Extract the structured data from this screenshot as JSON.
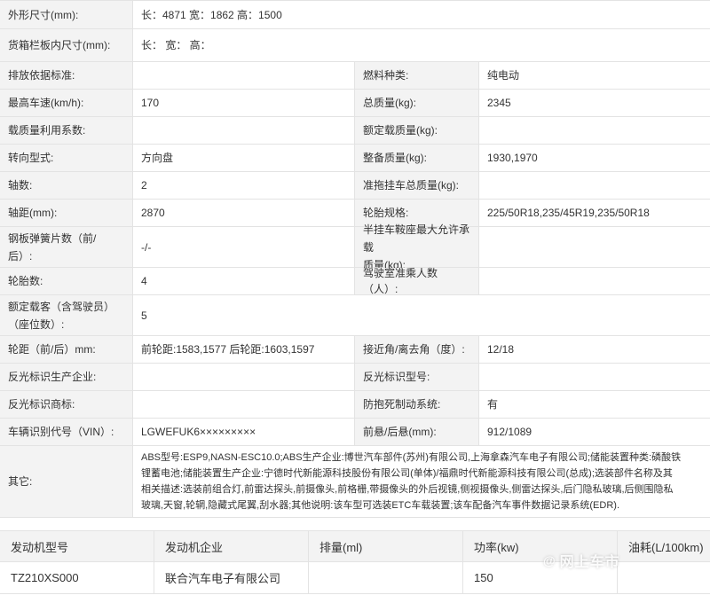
{
  "specs": {
    "r1": {
      "l": "外形尺寸(mm):",
      "v": "长：4871 宽：1862 高：1500"
    },
    "r2": {
      "l": "货箱栏板内尺寸(mm):",
      "v": "长： 宽： 高："
    },
    "r3": {
      "l1": "排放依据标准:",
      "v1": "",
      "l2": "燃料种类:",
      "v2": "纯电动"
    },
    "r4": {
      "l1": "最高车速(km/h):",
      "v1": "170",
      "l2": "总质量(kg):",
      "v2": "2345"
    },
    "r5": {
      "l1": "载质量利用系数:",
      "v1": "",
      "l2": "额定载质量(kg):",
      "v2": ""
    },
    "r6": {
      "l1": "转向型式:",
      "v1": "方向盘",
      "l2": "整备质量(kg):",
      "v2": "1930,1970"
    },
    "r7": {
      "l1": "轴数:",
      "v1": "2",
      "l2": "准拖挂车总质量(kg):",
      "v2": ""
    },
    "r8": {
      "l1": "轴距(mm):",
      "v1": "2870",
      "l2": "轮胎规格:",
      "v2": "225/50R18,235/45R19,235/50R18"
    },
    "r9": {
      "l1a": "钢板弹簧片数（前/",
      "l1b": "后）:",
      "v1": "-/-",
      "l2a": "半挂车鞍座最大允许承载",
      "l2b": "质量(kg):",
      "v2": ""
    },
    "r10": {
      "l1": "轮胎数:",
      "v1": "4",
      "l2": "驾驶室准乘人数（人）:",
      "v2": ""
    },
    "r11": {
      "la": "额定载客（含驾驶员）",
      "lb": "（座位数）:",
      "v": "5"
    },
    "r12": {
      "l1": "轮距（前/后）mm:",
      "v1": "前轮距:1583,1577 后轮距:1603,1597",
      "l2": "接近角/离去角（度）:",
      "v2": "12/18"
    },
    "r13": {
      "l1": "反光标识生产企业:",
      "v1": "",
      "l2": "反光标识型号:",
      "v2": ""
    },
    "r14": {
      "l1": "反光标识商标:",
      "v1": "",
      "l2": "防抱死制动系统:",
      "v2": "有"
    },
    "r15": {
      "l1": "车辆识别代号（VIN）:",
      "v1": "LGWEFUK6×××××××××",
      "l2": "前悬/后悬(mm):",
      "v2": "912/1089"
    },
    "r16": {
      "l": "其它:",
      "lines": [
        "ABS型号:ESP9,NASN-ESC10.0;ABS生产企业:博世汽车部件(苏州)有限公司,上海拿森汽车电子有限公司;储能装置种类:磷酸铁",
        "锂蓄电池;储能装置生产企业:宁德时代新能源科技股份有限公司(单体)/福鼎时代新能源科技有限公司(总成);选装部件名称及其",
        "相关描述:选装前组合灯,前雷达探头,前摄像头,前格栅,带摄像头的外后视镜,侧视摄像头,侧雷达探头,后门隐私玻璃,后侧围隐私",
        "玻璃,天窗,轮辋,隐藏式尾翼,刮水器;其他说明:该车型可选装ETC车载装置;该车配备汽车事件数据记录系统(EDR)."
      ]
    }
  },
  "engine": {
    "headers": [
      "发动机型号",
      "发动机企业",
      "排量(ml)",
      "功率(kw)",
      "油耗(L/100km)"
    ],
    "rows": [
      [
        "TZ210XS000",
        "联合汽车电子有限公司",
        "",
        "150",
        ""
      ]
    ]
  },
  "watermark": {
    "at": "@",
    "text": "网上车市"
  }
}
